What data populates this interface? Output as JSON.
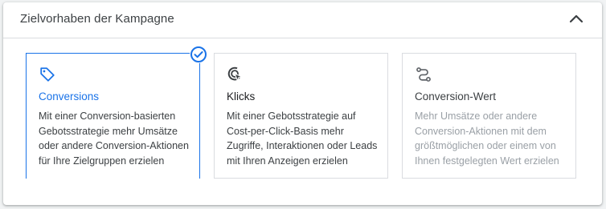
{
  "panel": {
    "title": "Zielvorhaben der Kampagne",
    "collapse_icon": "chevron-up-icon"
  },
  "cards": [
    {
      "title": "Conversions",
      "description": "Mit einer Conversion-basierten Gebotsstrategie mehr Umsätze oder andere Conversion-Aktionen für Ihre Zielgruppen erzielen",
      "icon": "tag-icon",
      "state": "selected"
    },
    {
      "title": "Klicks",
      "description": "Mit einer Gebotsstrategie auf Cost-per-Click-Basis mehr Zugriffe, Interaktionen oder Leads mit Ihren Anzeigen erzielen",
      "icon": "cursor-click-icon",
      "state": "default"
    },
    {
      "title": "Conversion-Wert",
      "description": "Mehr Umsätze oder andere Conversion-Aktionen mit dem größtmöglichen oder einem von Ihnen festgelegten Wert erzielen",
      "icon": "conversion-path-icon",
      "state": "disabled"
    }
  ],
  "selected_badge_icon": "check-circle-icon",
  "colors": {
    "accent": "#1a73e8",
    "text": "#202124",
    "muted": "#9aa0a6",
    "border": "#dadce0"
  }
}
